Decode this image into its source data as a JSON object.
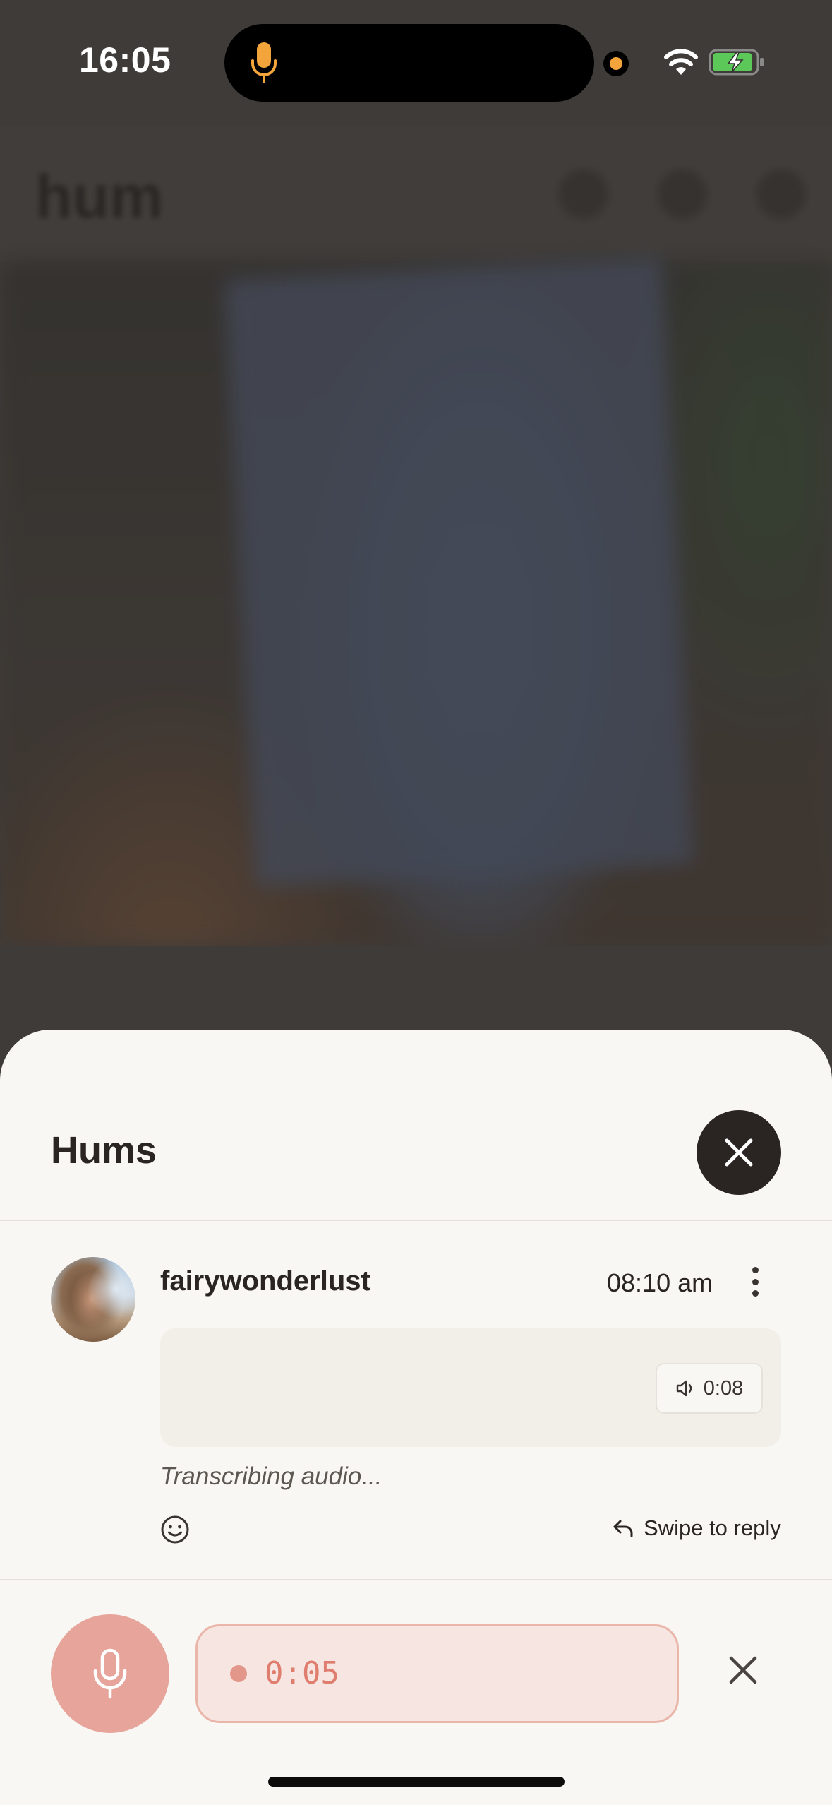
{
  "status_bar": {
    "time": "16:05",
    "icons": [
      "microphone-icon",
      "camera-indicator-dot",
      "wifi-icon",
      "battery-charging-icon"
    ],
    "colors": {
      "mic_indicator": "#f3a53c",
      "battery_fill": "#5cc85a"
    }
  },
  "background_app": {
    "logo": "hum"
  },
  "sheet": {
    "title": "Hums",
    "close_icon": "close-icon"
  },
  "hum": {
    "username": "fairywonderlust",
    "time": "08:10 am",
    "duration": "0:08",
    "transcript_status": "Transcribing audio...",
    "swipe_hint": "Swipe to reply",
    "icons": [
      "more-vertical-icon",
      "speaker-icon",
      "emoji-icon",
      "reply-arrow-icon"
    ]
  },
  "recorder": {
    "elapsed": "0:05",
    "colors": {
      "mic_button": "#e6a49a",
      "pill_bg": "#f6e5e0",
      "accent": "#df7d6e"
    }
  }
}
